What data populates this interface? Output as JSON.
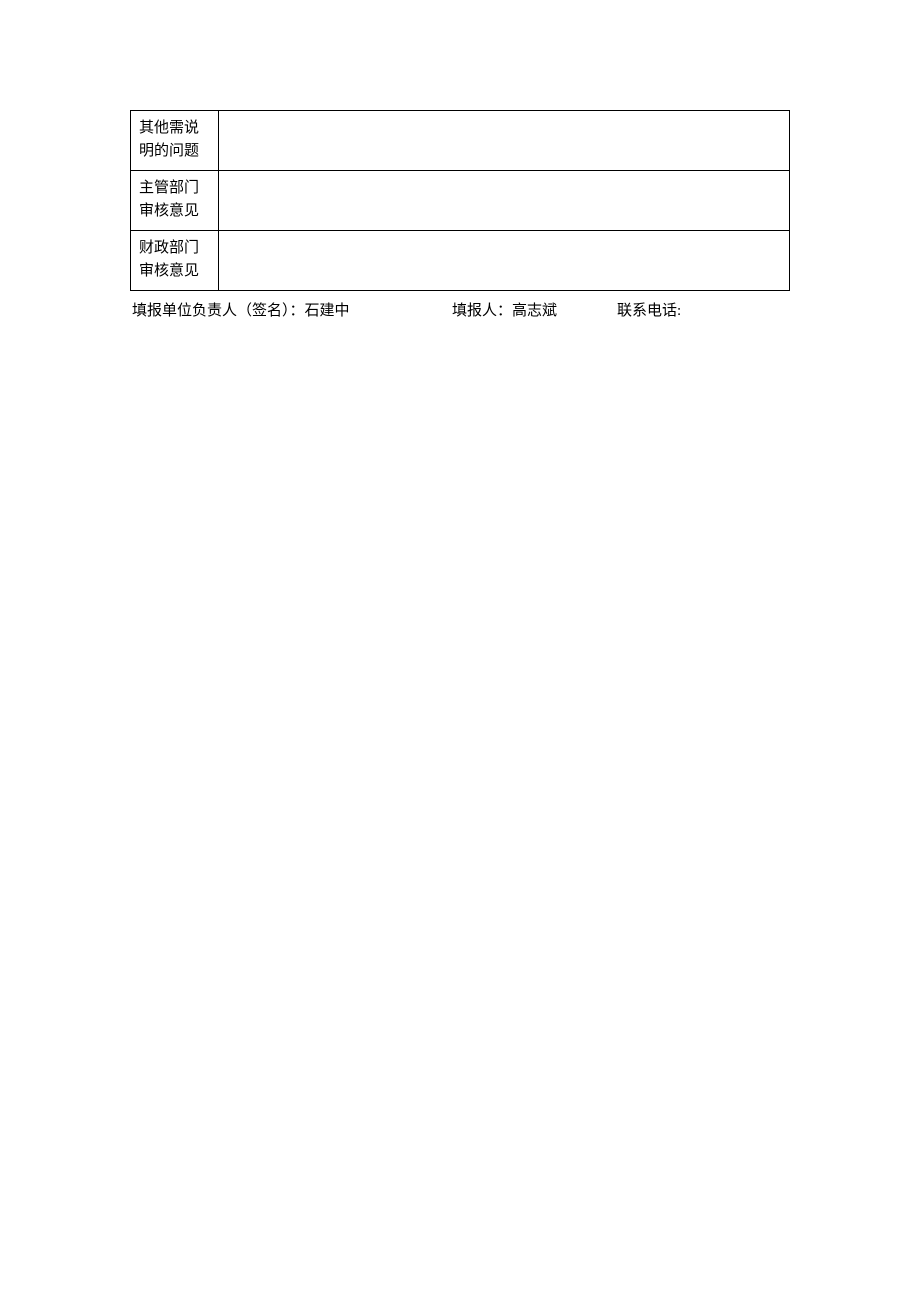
{
  "table": {
    "rows": [
      {
        "label": "其他需说明的问题",
        "content": ""
      },
      {
        "label": "主管部门审核意见",
        "content": ""
      },
      {
        "label": "财政部门审核意见",
        "content": ""
      }
    ]
  },
  "footer": {
    "responsible_label": "填报单位负责人（签名）：",
    "responsible_value": "石建中",
    "preparer_label": "填报人：",
    "preparer_value": "高志斌",
    "phone_label": "联系电话:",
    "phone_value": ""
  }
}
